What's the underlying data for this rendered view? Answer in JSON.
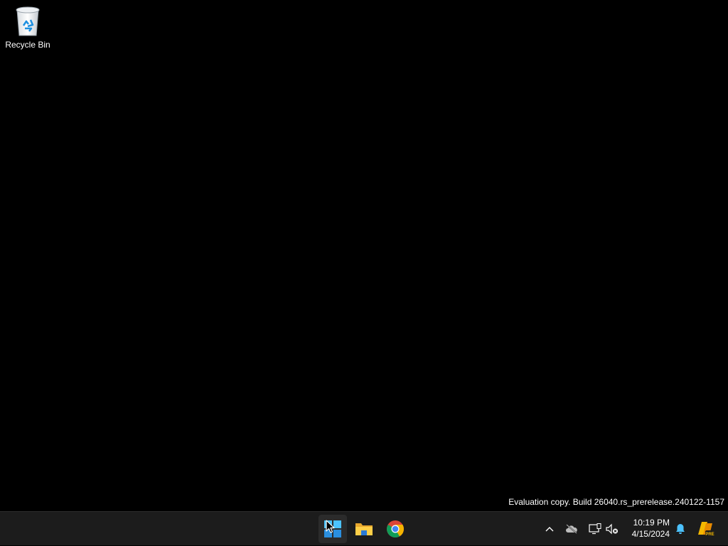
{
  "desktop": {
    "icons": [
      {
        "label": "Recycle Bin",
        "icon": "recycle-bin-icon"
      }
    ],
    "watermark": "Evaluation copy. Build 26040.rs_prerelease.240122-1157"
  },
  "taskbar": {
    "background": "#1c1c1c",
    "pinned_apps": [
      {
        "name": "Start",
        "icon": "windows-logo-icon"
      },
      {
        "name": "File Explorer",
        "icon": "folder-icon"
      },
      {
        "name": "Google Chrome",
        "icon": "chrome-icon"
      }
    ],
    "tray": {
      "icons": [
        "chevron-up-icon",
        "onedrive-offline-icon",
        "network-icon",
        "volume-muted-icon",
        "notification-bell-icon",
        "copilot-pre-icon"
      ],
      "time": "10:19 PM",
      "date": "4/15/2024"
    }
  }
}
